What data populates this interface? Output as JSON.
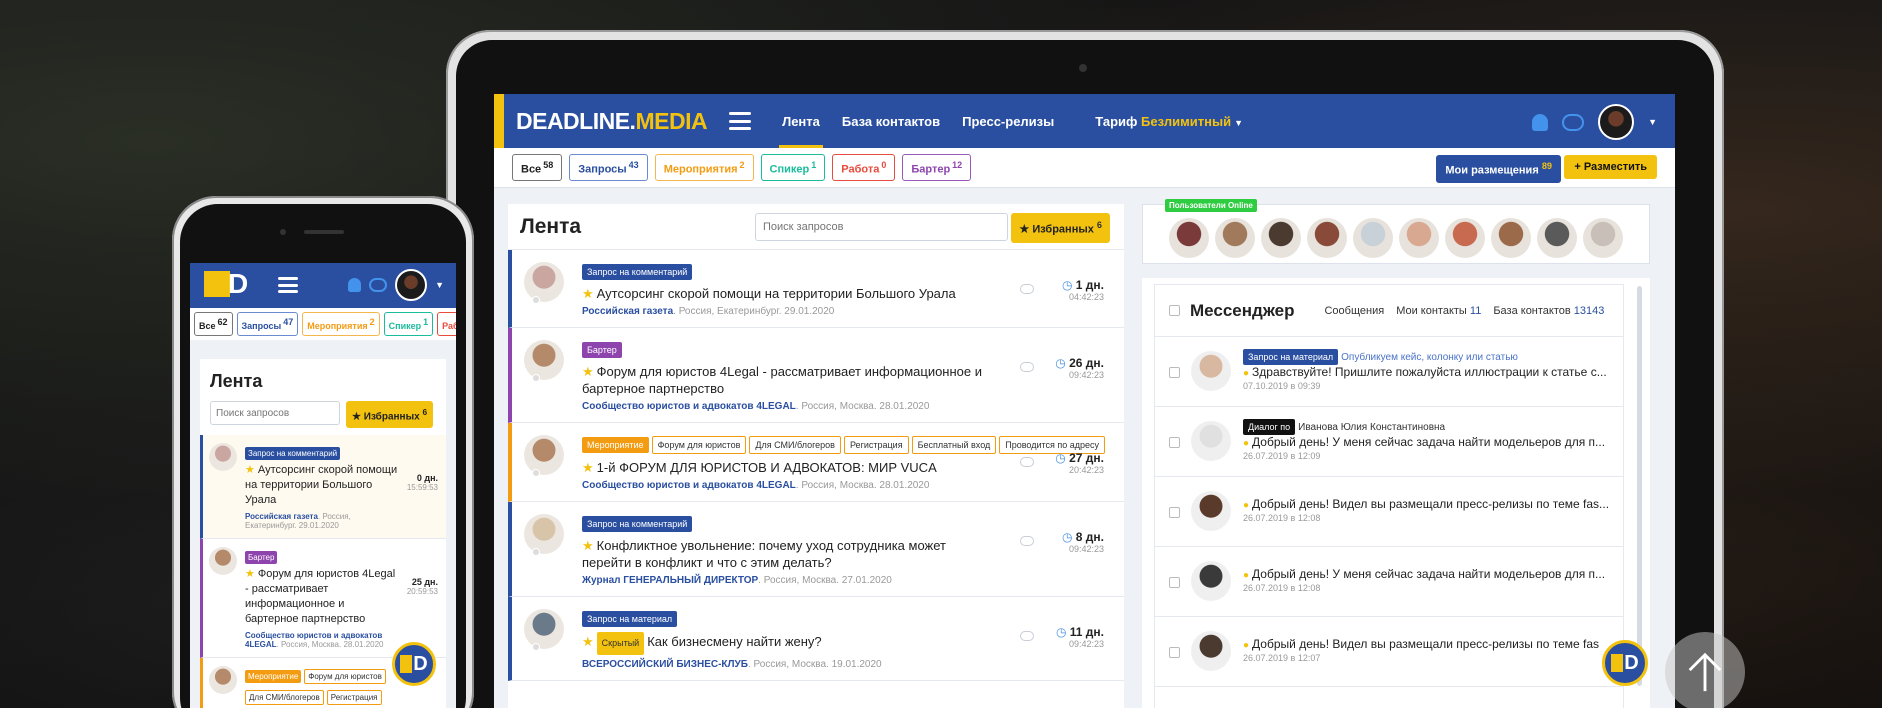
{
  "laptop": {
    "logo": {
      "part1": "DEADLINE.",
      "part2": "MEDIA"
    },
    "nav": [
      "Лента",
      "База контактов",
      "Пресс-релизы"
    ],
    "tariff": {
      "label": "Тариф",
      "value": "Безлимитный"
    },
    "filters": [
      {
        "label": "Все",
        "count": "58",
        "kind": "all"
      },
      {
        "label": "Запросы",
        "count": "43",
        "kind": "req"
      },
      {
        "label": "Мероприятия",
        "count": "2",
        "kind": "ev"
      },
      {
        "label": "Спикер",
        "count": "1",
        "kind": "sp"
      },
      {
        "label": "Работа",
        "count": "0",
        "kind": "job"
      },
      {
        "label": "Бартер",
        "count": "12",
        "kind": "bar"
      }
    ],
    "my_placements": {
      "label": "Мои размещения",
      "count": "89"
    },
    "place_button": "Разместить",
    "feed": {
      "title": "Лента",
      "search_placeholder": "Поиск запросов",
      "favorites": {
        "label": "Избранных",
        "count": "6"
      },
      "items": [
        {
          "tags": [
            {
              "text": "Запрос на комментарий",
              "style": "blue"
            }
          ],
          "title": "Аутсорсинг скорой помощи на территории Большого Урала",
          "source": "Российская газета",
          "meta": ". Россия, Екатеринбург. 29.01.2020",
          "days": "1 дн.",
          "time": "04:42:23",
          "accent": "#2a4fa0",
          "av": "#c9a7a0"
        },
        {
          "tags": [
            {
              "text": "Бартер",
              "style": "purple"
            }
          ],
          "title": "Форум для юристов 4Legal - рассматривает информационное и бартерное партнерство",
          "source": "Сообщество юристов и адвокатов 4LEGAL",
          "meta": ". Россия, Москва. 28.01.2020",
          "days": "26 дн.",
          "time": "09:42:23",
          "accent": "#8e44ad",
          "av": "#b48a6a"
        },
        {
          "tags": [
            {
              "text": "Мероприятие",
              "style": "orange"
            },
            {
              "text": "Форум для юристов",
              "style": "out"
            },
            {
              "text": "Для СМИ/блогеров",
              "style": "out"
            },
            {
              "text": "Регистрация",
              "style": "out"
            },
            {
              "text": "Бесплатный вход",
              "style": "out"
            },
            {
              "text": "Проводится по адресу",
              "style": "out"
            }
          ],
          "title": "1-й ФОРУМ ДЛЯ ЮРИСТОВ И АДВОКАТОВ: МИР VUCA",
          "source": "Сообщество юристов и адвокатов 4LEGAL",
          "meta": ". Россия, Москва. 28.01.2020",
          "days": "27 дн.",
          "time": "20:42:23",
          "accent": "#f39c12",
          "av": "#b48a6a"
        },
        {
          "tags": [
            {
              "text": "Запрос на комментарий",
              "style": "blue"
            }
          ],
          "title": "Конфликтное увольнение: почему уход сотрудника может перейти в конфликт и что с этим делать?",
          "source": "Журнал ГЕНЕРАЛЬНЫЙ ДИРЕКТОР",
          "meta": ". Россия, Москва. 27.01.2020",
          "days": "8 дн.",
          "time": "09:42:23",
          "accent": "#2a4fa0",
          "av": "#d8c4a8"
        },
        {
          "tags": [
            {
              "text": "Запрос на материал",
              "style": "blue"
            }
          ],
          "hidden": "Скрытый",
          "title": "Как бизнесмену найти жену?",
          "source": "ВСЕРОССИЙСКИЙ БИЗНЕС-КЛУБ",
          "meta": ". Россия, Москва. 19.01.2020",
          "days": "11 дн.",
          "time": "09:42:23",
          "accent": "#2a4fa0",
          "av": "#6b7a8a"
        }
      ]
    },
    "online": {
      "label": "Пользователи Online",
      "avatars": [
        "#7a3a3a",
        "#a07a5a",
        "#4a3a30",
        "#8a4a3a",
        "#c8d0d8",
        "#d8a890",
        "#c86a50",
        "#9a6a4a",
        "#5a5a5a",
        "#c8c0b8"
      ]
    },
    "messenger": {
      "title": "Мессенджер",
      "tabs": [
        {
          "label": "Сообщения",
          "count": ""
        },
        {
          "label": "Мои контакты",
          "count": "11"
        },
        {
          "label": "База контактов",
          "count": "13143"
        }
      ],
      "rows": [
        {
          "tag": "Запрос на материал",
          "tag_style": "blue",
          "head": "Опубликуем кейс, колонку или статью",
          "text": "Здравствуйте! Пришлите пожалуйста иллюстрации к статье с...",
          "date": "07.10.2019 в 09:39",
          "av": "#d8b8a0"
        },
        {
          "tag": "Диалог по",
          "tag_style": "dark",
          "head": "Иванова Юлия Константиновна",
          "text": "Добрый день! У меня сейчас задача найти модельеров для п...",
          "date": "26.07.2019 в 12:09",
          "av": "#e0e0e0"
        },
        {
          "tag": "",
          "tag_style": "",
          "head": "",
          "text": "Добрый день! Видел вы размещали пресс-релизы по теме fas...",
          "date": "26.07.2019 в 12:08",
          "av": "#5a3a2a"
        },
        {
          "tag": "",
          "tag_style": "",
          "head": "",
          "text": "Добрый день! У меня сейчас задача найти модельеров для п...",
          "date": "26.07.2019 в 12:08",
          "av": "#3a3a3a"
        },
        {
          "tag": "",
          "tag_style": "",
          "head": "",
          "text": "Добрый день! Видел вы размещали пресс-релизы по теме fas",
          "date": "26.07.2019 в 12:07",
          "av": "#4a3a30"
        }
      ]
    }
  },
  "phone": {
    "logo_letter": "D",
    "filters": [
      {
        "label": "Все",
        "count": "62",
        "kind": "all"
      },
      {
        "label": "Запросы",
        "count": "47",
        "kind": "req"
      },
      {
        "label": "Мероприятия",
        "count": "2",
        "kind": "ev"
      },
      {
        "label": "Спикер",
        "count": "1",
        "kind": "sp"
      },
      {
        "label": "Раб",
        "count": "",
        "kind": "job"
      }
    ],
    "feed_title": "Лента",
    "search_placeholder": "Поиск запросов",
    "favorites": {
      "label": "Избранных",
      "count": "6"
    },
    "items": [
      {
        "tags": [
          {
            "text": "Запрос на комментарий",
            "style": "blue"
          }
        ],
        "title": "Аутсорсинг скорой помощи на территории Большого Урала",
        "source": "Российская газета",
        "meta": ". Россия, Екатеринбург. 29.01.2020",
        "days": "0 дн.",
        "time": "15:59:53",
        "accent": "#2a4fa0",
        "av": "#c9a7a0",
        "bg": "#fffaf0"
      },
      {
        "tags": [
          {
            "text": "Бартер",
            "style": "purple"
          }
        ],
        "title": "Форум для юристов 4Legal - рассматривает информационное и бартерное партнерство",
        "source": "Сообщество юристов и адвокатов 4LEGAL",
        "meta": ". Россия, Москва. 28.01.2020",
        "days": "25 дн.",
        "time": "20:59:53",
        "accent": "#8e44ad",
        "av": "#b48a6a",
        "bg": "#fff"
      },
      {
        "tags": [
          {
            "text": "Мероприятие",
            "style": "orange"
          },
          {
            "text": "Форум для юристов",
            "style": "out"
          },
          {
            "text": "Для СМИ/блогеров",
            "style": "out"
          },
          {
            "text": "Регистрация",
            "style": "out"
          }
        ],
        "title": "",
        "source": "",
        "meta": "",
        "days": "",
        "time": "",
        "accent": "#f39c12",
        "av": "#b48a6a",
        "bg": "#fff"
      }
    ]
  }
}
